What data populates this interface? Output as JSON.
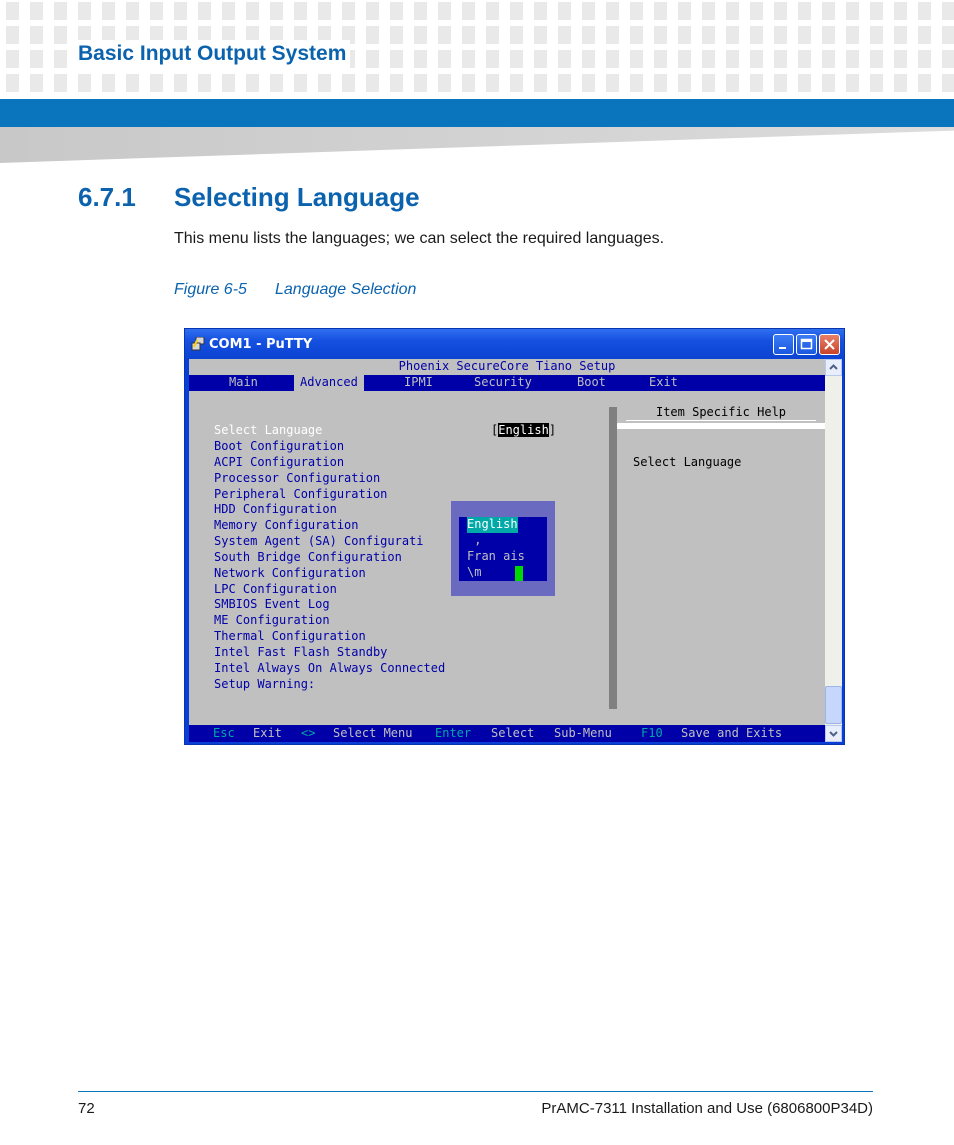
{
  "header": {
    "chapter_title": "Basic Input Output System"
  },
  "section": {
    "number": "6.7.1",
    "title": "Selecting Language",
    "intro": "This menu lists the languages; we can select the required languages."
  },
  "figure": {
    "number": "Figure 6-5",
    "title": "Language Selection"
  },
  "window": {
    "title": "COM1 - PuTTY",
    "app_icon": "putty-icon",
    "buttons": [
      "minimize-icon",
      "maximize-icon",
      "close-icon"
    ]
  },
  "bios": {
    "setup_title": "Phoenix SecureCore Tiano Setup",
    "menu": [
      "Main",
      "Advanced",
      "IPMI",
      "Security",
      "Boot",
      "Exit"
    ],
    "active_menu": "Advanced",
    "options": [
      "Select Language",
      "Boot Configuration",
      "ACPI Configuration",
      "Processor Configuration",
      "Peripheral Configuration",
      "HDD Configuration",
      "Memory Configuration",
      "System Agent (SA) Configurati",
      "South Bridge Configuration",
      "Network Configuration",
      "LPC Configuration",
      "SMBIOS Event Log",
      "ME Configuration",
      "Thermal Configuration",
      "Intel Fast Flash Standby",
      "Intel Always On Always Connected",
      "Setup Warning:"
    ],
    "language_value_open": "[",
    "language_value": "English",
    "language_value_close": "]",
    "help_heading": "Item Specific Help",
    "help_text": "Select Language",
    "popup_options": [
      "English",
      " ,",
      "Fran ais",
      "\\m"
    ],
    "status_bar": [
      {
        "key": "Esc",
        "label": "Exit"
      },
      {
        "key": "<>",
        "label": "Select Menu"
      },
      {
        "key": "Enter",
        "label": "Select"
      },
      {
        "key": "Sub-Menu",
        "label": ""
      },
      {
        "key": "F10",
        "label": "Save and Exits"
      }
    ]
  },
  "footer": {
    "page_number": "72",
    "doc_title": "PrAMC-7311 Installation and Use (6806800P34D)"
  }
}
